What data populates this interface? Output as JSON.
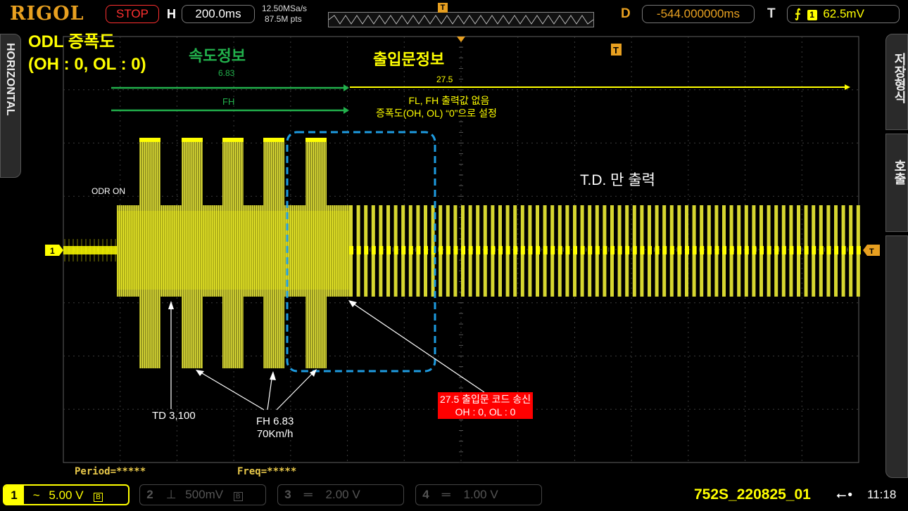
{
  "topbar": {
    "logo": "RIGOL",
    "run_state": "STOP",
    "timebase_label": "H",
    "timebase_value": "200.0ms",
    "sample_rate": "12.50MSa/s",
    "memory_depth": "87.5M pts",
    "delay_label": "D",
    "delay_value": "-544.000000ms",
    "trigger_label": "T",
    "trigger_channel": "1",
    "trigger_level": "62.5mV"
  },
  "side_tabs": {
    "left": "HORIZONTAL",
    "right_top": "저장형식",
    "right_bottom": "호출"
  },
  "measurements": {
    "period": "Period=*****",
    "freq": "Freq=*****"
  },
  "bottombar": {
    "channels": [
      {
        "num": "1",
        "coupling": "~",
        "scale": "5.00 V",
        "active": true
      },
      {
        "num": "2",
        "coupling": "⊥",
        "scale": "500mV",
        "active": false
      },
      {
        "num": "3",
        "coupling": "═",
        "scale": "2.00 V",
        "active": false
      },
      {
        "num": "4",
        "coupling": "═",
        "scale": "1.00 V",
        "active": false
      }
    ],
    "filename": "752S_220825_01",
    "time": "11:18"
  },
  "annotations": {
    "title_line1": "ODL 증폭도",
    "title_line2": "(OH : 0, OL : 0)",
    "speed_info": "속도정보",
    "speed_value": "6.83",
    "speed_fh": "FH",
    "entry_info": "출입문정보",
    "entry_value": "27.5",
    "entry_note1": "FL, FH 출력값 없음",
    "entry_note2": "증폭도(OH, OL) “0”으로 설정",
    "odr_on": "ODR ON",
    "td_only": "T.D. 만 출력",
    "td": "TD 3,100",
    "fh_line1": "FH 6.83",
    "fh_line2": "70Km/h",
    "code_line1": "27.5 출입문 코드 송신",
    "code_line2": "OH : 0, OL : 0"
  },
  "colors": {
    "trace": "#ffff00",
    "accent_orange": "#e8a020",
    "green": "#22b14c",
    "dashbox": "#1e9be0",
    "grid": "#555555"
  },
  "icons": [
    "stop-badge",
    "trigger-edge-icon",
    "usb-icon",
    "trigger-marker-icon",
    "channel1-marker-icon"
  ]
}
